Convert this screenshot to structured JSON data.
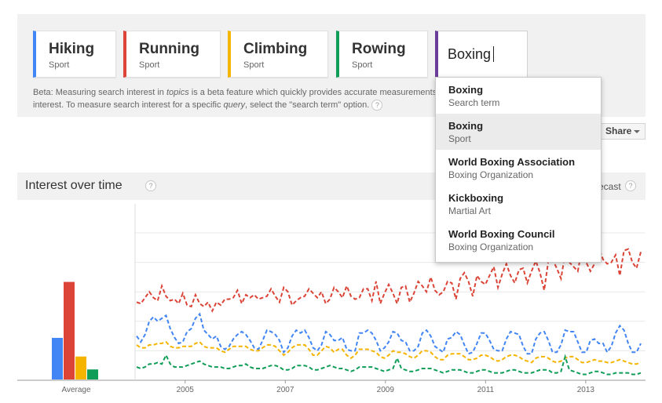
{
  "compare": {
    "terms": [
      {
        "name": "Hiking",
        "type": "Sport",
        "color": "#4285f4"
      },
      {
        "name": "Running",
        "type": "Sport",
        "color": "#db4437"
      },
      {
        "name": "Climbing",
        "type": "Sport",
        "color": "#f4b400"
      },
      {
        "name": "Rowing",
        "type": "Sport",
        "color": "#0f9d58"
      }
    ],
    "search_value": "Boxing",
    "search_color": "#6a3d9a",
    "beta_text_1": "Beta: Measuring search interest in ",
    "beta_topics": "topics",
    "beta_text_2": " is a beta feature which quickly provides accurate measurements",
    "beta_text_3": "interest. To measure search interest for a specific ",
    "beta_query": "query",
    "beta_text_4": ", select the \"search term\" option.",
    "help_glyph": "?"
  },
  "dropdown": {
    "items": [
      {
        "name": "Boxing",
        "type": "Search term"
      },
      {
        "name": "Boxing",
        "type": "Sport"
      },
      {
        "name": "World Boxing Association",
        "type": "Boxing Organization"
      },
      {
        "name": "Kickboxing",
        "type": "Martial Art"
      },
      {
        "name": "World Boxing Council",
        "type": "Boxing Organization"
      }
    ],
    "highlighted_index": 1
  },
  "toolbar": {
    "share_label": "Share"
  },
  "interest": {
    "title": "Interest over time",
    "forecast_label": "ecast",
    "help_glyph": "?"
  },
  "chart_data": {
    "type": "line",
    "averages": {
      "xlabel": "Average",
      "series": [
        {
          "color": "#4285f4",
          "value": 29
        },
        {
          "color": "#db4437",
          "value": 68
        },
        {
          "color": "#f4b400",
          "value": 16
        },
        {
          "color": "#0f9d58",
          "value": 7
        }
      ],
      "ylim": [
        0,
        100
      ]
    },
    "xlim": [
      2004,
      2014.1
    ],
    "ylim": [
      0,
      100
    ],
    "x_ticks": [
      2005,
      2007,
      2009,
      2011,
      2013
    ],
    "x_tick_labels": [
      "2005",
      "2007",
      "2009",
      "2011",
      "2013"
    ],
    "gridlines": [
      20,
      40,
      60,
      80,
      100
    ],
    "series": [
      {
        "color": "#db4437",
        "dashed": true,
        "values": [
          53,
          52,
          56,
          60,
          56,
          54,
          64,
          57,
          54,
          55,
          52,
          59,
          51,
          50,
          58,
          52,
          50,
          53,
          47,
          53,
          51,
          55,
          55,
          56,
          61,
          52,
          58,
          56,
          58,
          55,
          56,
          57,
          62,
          57,
          53,
          63,
          60,
          51,
          54,
          56,
          57,
          62,
          59,
          56,
          60,
          52,
          55,
          63,
          60,
          56,
          64,
          57,
          55,
          56,
          62,
          62,
          54,
          67,
          52,
          59,
          65,
          59,
          52,
          63,
          64,
          53,
          59,
          67,
          64,
          60,
          70,
          61,
          58,
          60,
          67,
          66,
          55,
          69,
          73,
          67,
          57,
          71,
          67,
          65,
          71,
          77,
          63,
          72,
          79,
          71,
          66,
          75,
          76,
          66,
          74,
          81,
          73,
          61,
          81,
          82,
          76,
          69,
          86,
          80,
          77,
          74,
          89,
          80,
          74,
          79,
          90,
          82,
          79,
          80,
          85,
          71,
          88,
          89,
          80,
          76,
          87
        ]
      },
      {
        "color": "#4285f4",
        "dashed": true,
        "values": [
          30,
          26,
          31,
          40,
          43,
          40,
          42,
          44,
          35,
          29,
          25,
          26,
          33,
          35,
          42,
          45,
          34,
          31,
          28,
          30,
          23,
          21,
          23,
          28,
          31,
          33,
          31,
          27,
          22,
          21,
          27,
          34,
          33,
          31,
          27,
          19,
          22,
          30,
          34,
          32,
          34,
          29,
          22,
          20,
          24,
          33,
          31,
          27,
          27,
          29,
          21,
          20,
          20,
          32,
          32,
          34,
          32,
          27,
          20,
          22,
          26,
          33,
          32,
          27,
          26,
          20,
          20,
          23,
          32,
          34,
          30,
          23,
          21,
          19,
          28,
          29,
          33,
          31,
          24,
          18,
          19,
          25,
          32,
          32,
          27,
          21,
          20,
          20,
          28,
          33,
          32,
          31,
          23,
          18,
          18,
          28,
          32,
          33,
          27,
          19,
          19,
          24,
          34,
          33,
          33,
          26,
          19,
          19,
          27,
          28,
          25,
          25,
          19,
          23,
          32,
          37,
          34,
          25,
          19,
          19,
          25
        ]
      },
      {
        "color": "#f4b400",
        "dashed": true,
        "values": [
          24,
          22,
          22,
          24,
          24,
          25,
          25,
          26,
          23,
          22,
          22,
          23,
          23,
          23,
          25,
          26,
          23,
          22,
          22,
          22,
          20,
          19,
          21,
          23,
          23,
          23,
          23,
          21,
          20,
          20,
          22,
          24,
          24,
          23,
          20,
          17,
          19,
          22,
          24,
          24,
          24,
          21,
          17,
          17,
          20,
          23,
          22,
          19,
          21,
          21,
          17,
          15,
          17,
          21,
          21,
          21,
          20,
          19,
          16,
          15,
          17,
          20,
          19,
          19,
          18,
          16,
          15,
          17,
          20,
          20,
          19,
          16,
          14,
          14,
          17,
          18,
          18,
          18,
          16,
          14,
          14,
          15,
          17,
          17,
          16,
          14,
          13,
          14,
          16,
          17,
          17,
          16,
          14,
          13,
          12,
          15,
          16,
          16,
          15,
          13,
          12,
          13,
          15,
          16,
          16,
          14,
          12,
          12,
          13,
          14,
          13,
          13,
          12,
          12,
          13,
          14,
          13,
          12,
          11,
          11,
          12
        ]
      },
      {
        "color": "#0f9d58",
        "dashed": true,
        "values": [
          9,
          8,
          9,
          11,
          11,
          12,
          11,
          17,
          11,
          9,
          9,
          9,
          10,
          11,
          12,
          13,
          11,
          10,
          9,
          9,
          9,
          8,
          8,
          9,
          10,
          10,
          11,
          9,
          8,
          8,
          8,
          9,
          10,
          10,
          9,
          7,
          7,
          8,
          10,
          10,
          10,
          9,
          7,
          7,
          8,
          9,
          10,
          9,
          8,
          8,
          7,
          6,
          7,
          9,
          9,
          9,
          9,
          8,
          7,
          6,
          7,
          8,
          15,
          8,
          7,
          6,
          6,
          7,
          8,
          8,
          8,
          7,
          6,
          5,
          6,
          7,
          7,
          7,
          6,
          5,
          5,
          6,
          7,
          7,
          6,
          5,
          5,
          5,
          6,
          7,
          7,
          6,
          5,
          5,
          5,
          6,
          7,
          7,
          7,
          5,
          5,
          6,
          16,
          7,
          6,
          5,
          4,
          4,
          5,
          6,
          6,
          5,
          4,
          4,
          5,
          5,
          5,
          5,
          4,
          4,
          5
        ]
      }
    ]
  }
}
